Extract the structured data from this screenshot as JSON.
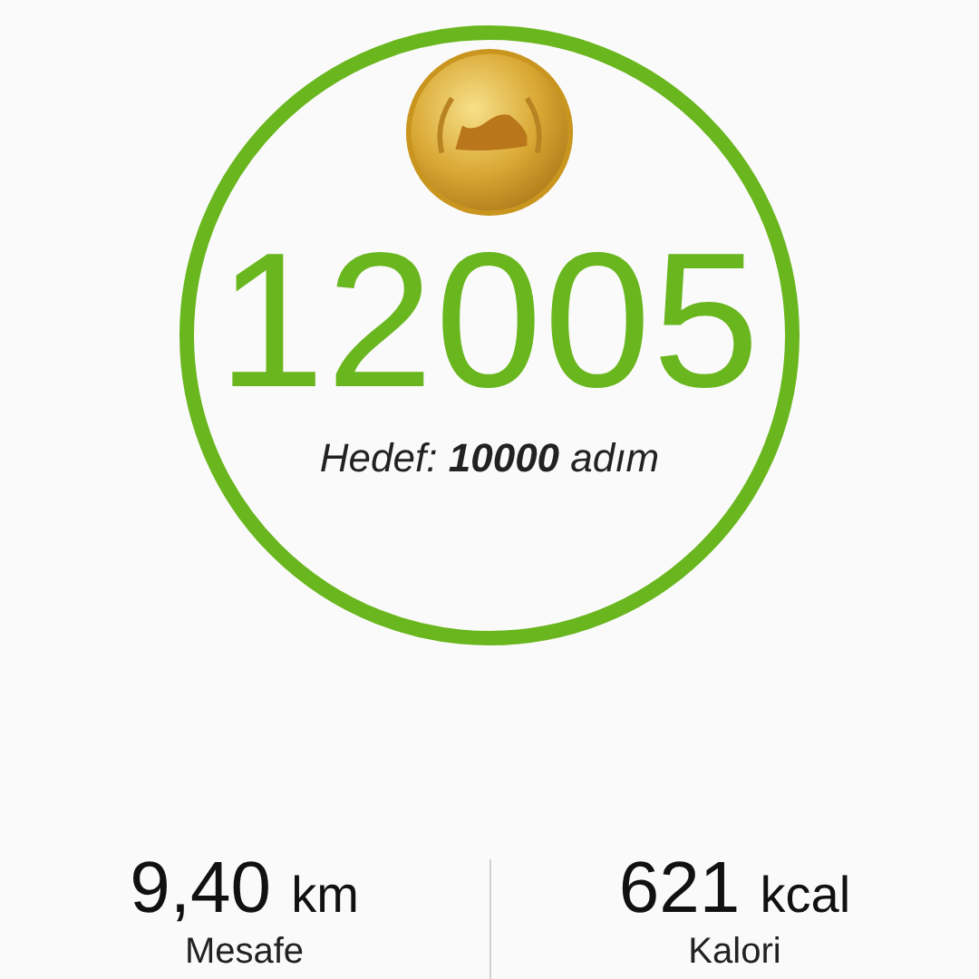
{
  "steps": {
    "count": "12005",
    "goal": "Hedef: **10000** adım"
  },
  "stats": [
    {
      "value": "9,40",
      "unit": "km",
      "label": "Mesafe"
    },
    {
      "value": "621",
      "unit": "kcal",
      "label": "Kalori"
    }
  ]
}
